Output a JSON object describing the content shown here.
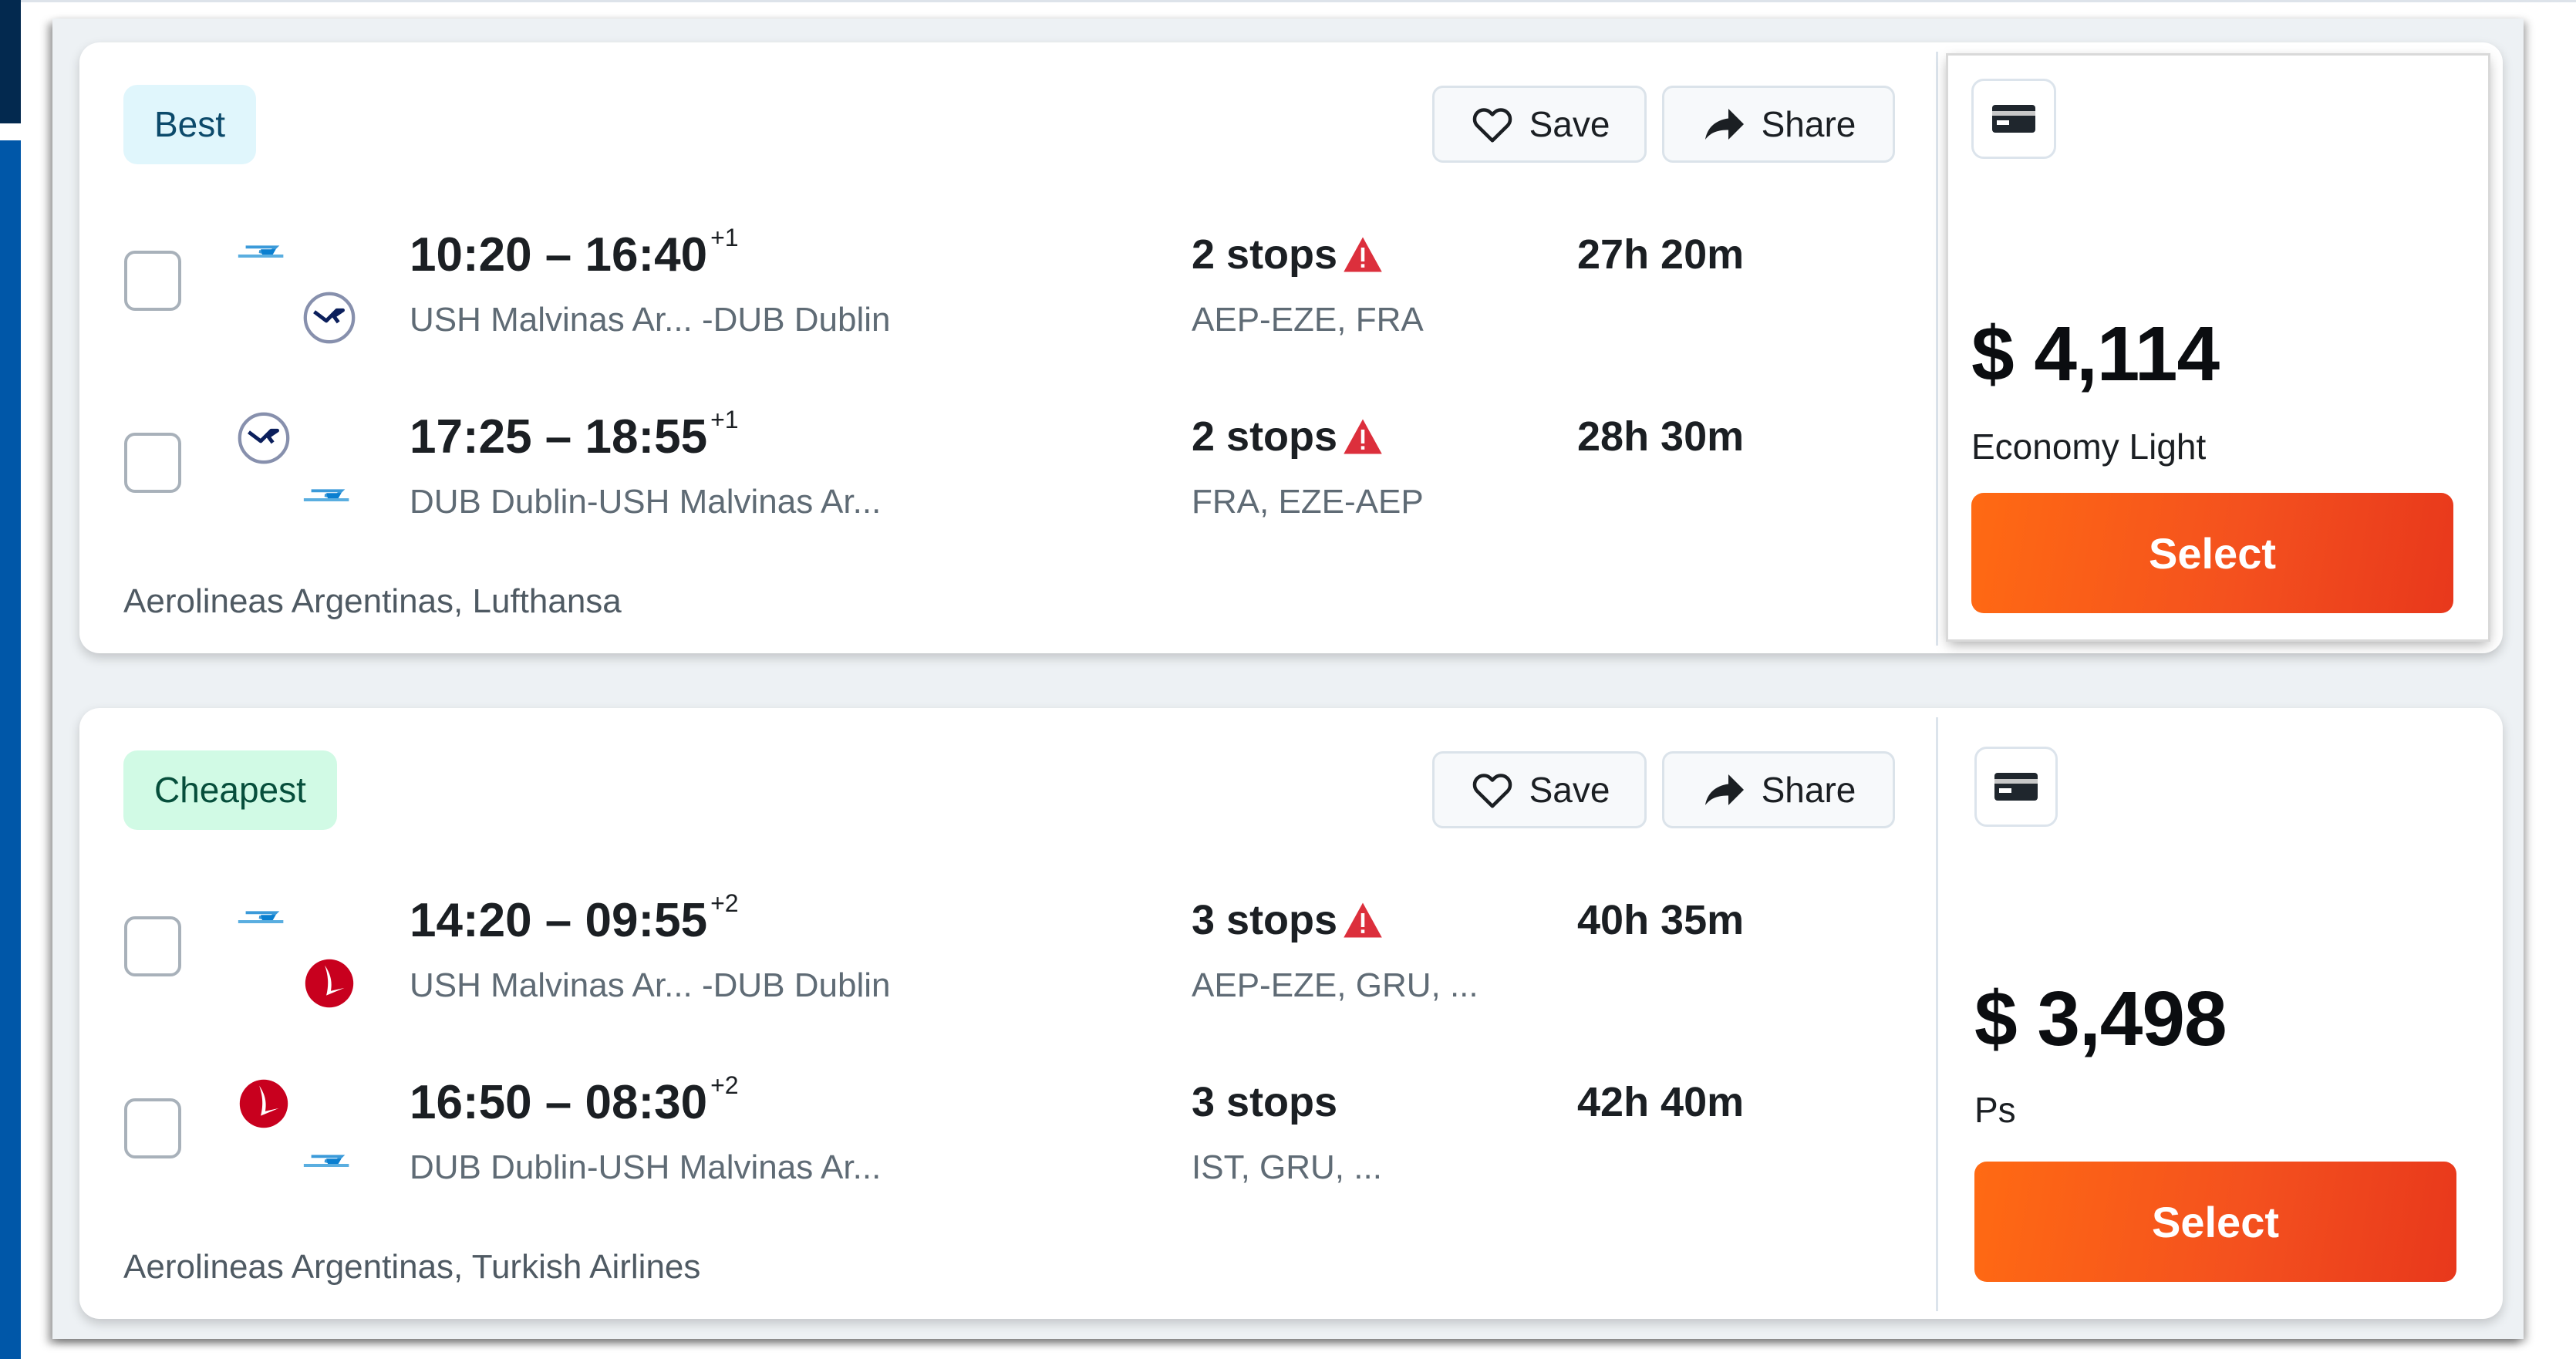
{
  "results": [
    {
      "badge": "Best",
      "save_label": "Save",
      "share_label": "Share",
      "legs": [
        {
          "time": "10:20 – 16:40",
          "day_offset": "+1",
          "route": "USH Malvinas Ar...  -DUB Dublin",
          "stops": "2 stops",
          "stops_warning": true,
          "via": "AEP-EZE, FRA",
          "duration": "27h 20m",
          "logos": [
            "aerolineas-argentinas-logo",
            "lufthansa-logo"
          ]
        },
        {
          "time": "17:25 – 18:55",
          "day_offset": "+1",
          "route": "DUB Dublin-USH Malvinas Ar...",
          "stops": "2 stops",
          "stops_warning": true,
          "via": "FRA, EZE-AEP",
          "duration": "28h 30m",
          "logos": [
            "lufthansa-logo",
            "aerolineas-argentinas-logo"
          ]
        }
      ],
      "airlines": "Aerolineas Argentinas, Lufthansa",
      "price": "$ 4,114",
      "fare_class": "Economy Light",
      "select_label": "Select",
      "highlighted": true
    },
    {
      "badge": "Cheapest",
      "save_label": "Save",
      "share_label": "Share",
      "legs": [
        {
          "time": "14:20 – 09:55",
          "day_offset": "+2",
          "route": "USH Malvinas Ar...  -DUB Dublin",
          "stops": "3 stops",
          "stops_warning": true,
          "via": "AEP-EZE, GRU, ...",
          "duration": "40h 35m",
          "logos": [
            "aerolineas-argentinas-logo",
            "turkish-airlines-logo"
          ]
        },
        {
          "time": "16:50 – 08:30",
          "day_offset": "+2",
          "route": "DUB Dublin-USH Malvinas Ar...",
          "stops": "3 stops",
          "stops_warning": false,
          "via": "IST, GRU, ...",
          "duration": "42h 40m",
          "logos": [
            "turkish-airlines-logo",
            "aerolineas-argentinas-logo"
          ]
        }
      ],
      "airlines": "Aerolineas Argentinas, Turkish Airlines",
      "price": "$ 3,498",
      "fare_class": "Ps",
      "select_label": "Select",
      "highlighted": false
    }
  ],
  "colors": {
    "select_gradient_start": "#ff6a13",
    "select_gradient_end": "#e8381c",
    "best_badge_bg": "#e0f6fc",
    "cheapest_badge_bg": "#d1fae5",
    "warning": "#dc2f3c",
    "aerolineas_blue": "#0a7fd0",
    "lufthansa_navy": "#0b1f5c",
    "turkish_red": "#c8001e"
  }
}
